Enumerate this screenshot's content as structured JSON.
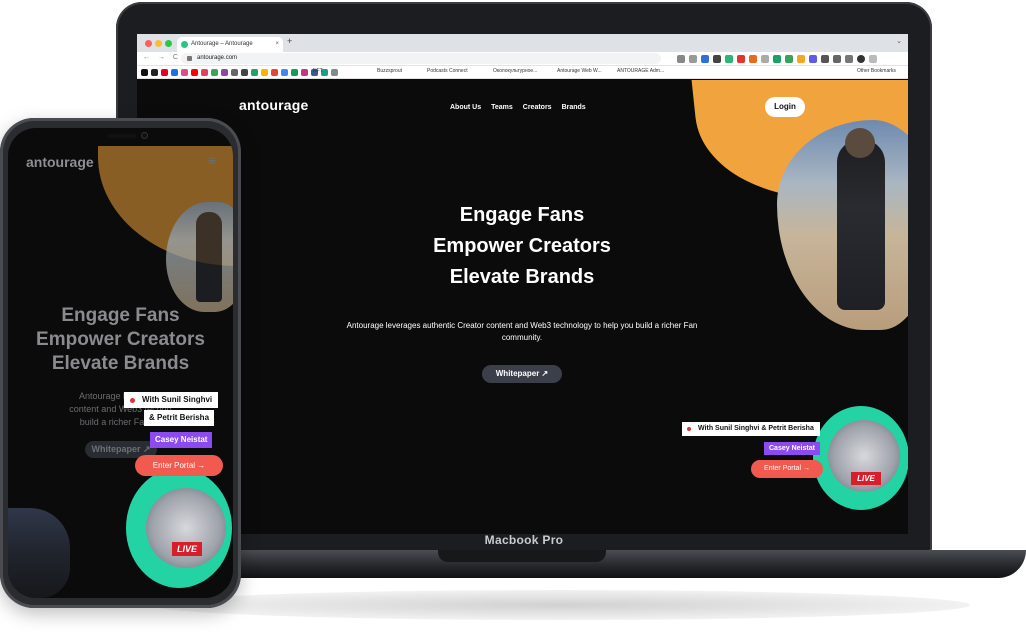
{
  "laptop": {
    "label": "Macbook Pro",
    "browser": {
      "tab_title": "Antourage – Antourage",
      "tab_close": "×",
      "new_tab": "+",
      "tab_menu": "⌄",
      "nav_buttons": "← → C",
      "url": "antourage.com",
      "bookmarks": [
        "NFT",
        "Buzzsprout",
        "Podcasts Connect",
        "Околокультурное...",
        "Antourage Web W...",
        "ANTOURAGE Adm..."
      ],
      "other_bookmarks": "Other Bookmarks",
      "colors": {
        "close": "#ff5f57",
        "minimize": "#febc2e",
        "maximize": "#28c840"
      }
    },
    "site": {
      "logo": "antourage",
      "nav": [
        "About Us",
        "Teams",
        "Creators",
        "Brands"
      ],
      "login": "Login",
      "hero_lines": [
        "Engage Fans",
        "Empower Creators",
        "Elevate Brands"
      ],
      "subtitle": "Antourage leverages authentic Creator content and Web3 technology to help you build a richer Fan community.",
      "whitepaper": "Whitepaper ↗",
      "live_tag_primary": "With Sunil Singhvi & Petrit Berisha",
      "live_tag_secondary": "Casey Neistat",
      "enter_portal": "Enter Portal →",
      "live_badge": "LIVE"
    }
  },
  "phone": {
    "logo": "antourage",
    "menu_icon": "≡",
    "hero_lines": [
      "Engage Fans",
      "Empower Creators",
      "Elevate Brands"
    ],
    "subtitle_lines": [
      "Antourage leverages",
      "content and Web3 techno",
      "build a richer Fan co"
    ],
    "whitepaper": "Whitepaper ↗",
    "live_tag_line1": "With Sunil Singhvi",
    "live_tag_line2": "& Petrit Berisha",
    "live_tag_secondary": "Casey Neistat",
    "enter_portal": "Enter Portal →",
    "live_badge": "LIVE"
  },
  "colors": {
    "accent_orange": "#f1a43d",
    "accent_green": "#23d3a4",
    "accent_purple": "#8b4bf0",
    "portal_red": "#f25a4f",
    "live_red": "#d71e2b"
  }
}
